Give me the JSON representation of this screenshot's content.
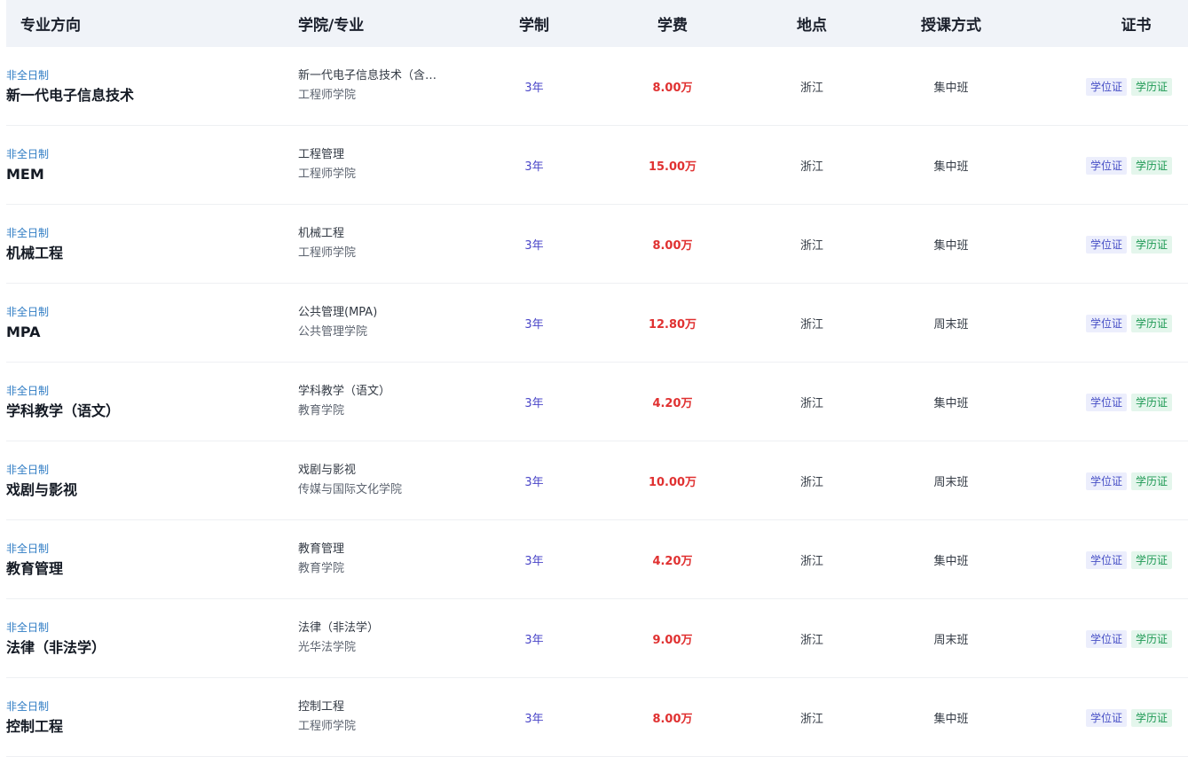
{
  "header": {
    "major": "专业方向",
    "college_program": "学院/专业",
    "duration": "学制",
    "tuition": "学费",
    "location": "地点",
    "teaching_mode": "授课方式",
    "certificate": "证书"
  },
  "rows": [
    {
      "type": "非全日制",
      "major": "新一代电子信息技术",
      "program": "新一代电子信息技术（含…",
      "college": "工程师学院",
      "duration": "3年",
      "tuition": "8.00万",
      "location": "浙江",
      "mode": "集中班",
      "cert_degree": "学位证",
      "cert_edu": "学历证"
    },
    {
      "type": "非全日制",
      "major": "MEM",
      "program": "工程管理",
      "college": "工程师学院",
      "duration": "3年",
      "tuition": "15.00万",
      "location": "浙江",
      "mode": "集中班",
      "cert_degree": "学位证",
      "cert_edu": "学历证"
    },
    {
      "type": "非全日制",
      "major": "机械工程",
      "program": "机械工程",
      "college": "工程师学院",
      "duration": "3年",
      "tuition": "8.00万",
      "location": "浙江",
      "mode": "集中班",
      "cert_degree": "学位证",
      "cert_edu": "学历证"
    },
    {
      "type": "非全日制",
      "major": "MPA",
      "program": "公共管理(MPA)",
      "college": "公共管理学院",
      "duration": "3年",
      "tuition": "12.80万",
      "location": "浙江",
      "mode": "周末班",
      "cert_degree": "学位证",
      "cert_edu": "学历证"
    },
    {
      "type": "非全日制",
      "major": "学科教学（语文）",
      "program": "学科教学（语文）",
      "college": "教育学院",
      "duration": "3年",
      "tuition": "4.20万",
      "location": "浙江",
      "mode": "集中班",
      "cert_degree": "学位证",
      "cert_edu": "学历证"
    },
    {
      "type": "非全日制",
      "major": "戏剧与影视",
      "program": "戏剧与影视",
      "college": "传媒与国际文化学院",
      "duration": "3年",
      "tuition": "10.00万",
      "location": "浙江",
      "mode": "周末班",
      "cert_degree": "学位证",
      "cert_edu": "学历证"
    },
    {
      "type": "非全日制",
      "major": "教育管理",
      "program": "教育管理",
      "college": "教育学院",
      "duration": "3年",
      "tuition": "4.20万",
      "location": "浙江",
      "mode": "集中班",
      "cert_degree": "学位证",
      "cert_edu": "学历证"
    },
    {
      "type": "非全日制",
      "major": "法律（非法学）",
      "program": "法律（非法学）",
      "college": "光华法学院",
      "duration": "3年",
      "tuition": "9.00万",
      "location": "浙江",
      "mode": "周末班",
      "cert_degree": "学位证",
      "cert_edu": "学历证"
    },
    {
      "type": "非全日制",
      "major": "控制工程",
      "program": "控制工程",
      "college": "工程师学院",
      "duration": "3年",
      "tuition": "8.00万",
      "location": "浙江",
      "mode": "集中班",
      "cert_degree": "学位证",
      "cert_edu": "学历证"
    }
  ]
}
